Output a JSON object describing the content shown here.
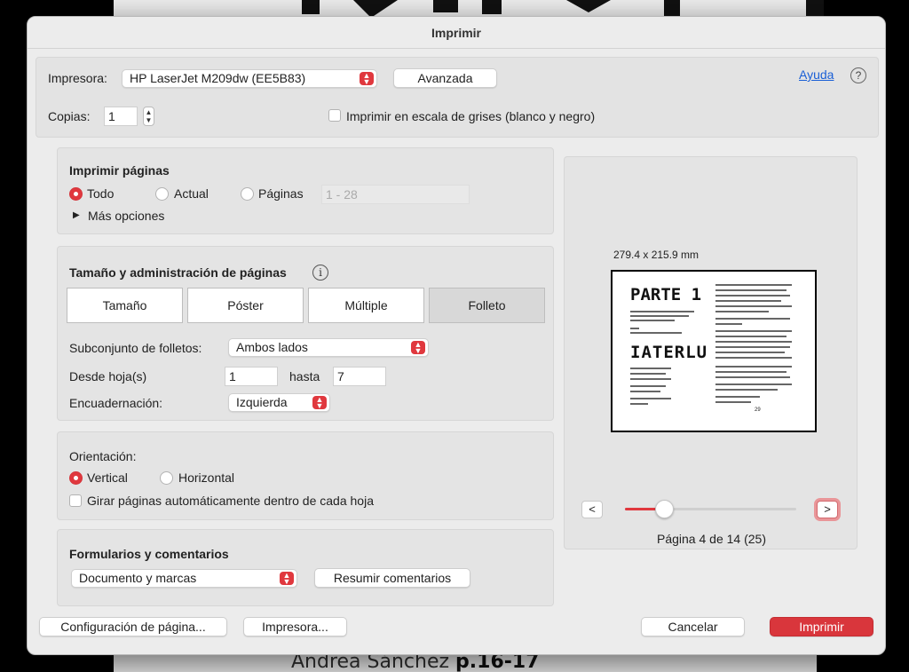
{
  "background": {
    "caption_name": "Andrea Sánchez",
    "caption_pages": "p.16-17"
  },
  "dialog": {
    "title": "Imprimir",
    "printer": {
      "label": "Impresora:",
      "value": "HP LaserJet M209dw (EE5B83)",
      "advanced_button": "Avanzada"
    },
    "help": {
      "link": "Ayuda",
      "icon": "?"
    },
    "copies": {
      "label": "Copias:",
      "value": "1"
    },
    "grayscale_label": "Imprimir en escala de grises (blanco y negro)",
    "print_pages": {
      "title": "Imprimir páginas",
      "options": [
        "Todo",
        "Actual",
        "Páginas"
      ],
      "selected": "Todo",
      "range_placeholder": "1 - 28",
      "more_options": "Más opciones"
    },
    "page_size": {
      "title": "Tamaño y administración de páginas",
      "info_icon": "i",
      "tabs": [
        "Tamaño",
        "Póster",
        "Múltiple",
        "Folleto"
      ],
      "selected_tab": "Folleto",
      "booklet_subset_label": "Subconjunto de folletos:",
      "booklet_subset_value": "Ambos lados",
      "from_sheet_label": "Desde hoja(s)",
      "from_value": "1",
      "to_label": "hasta",
      "to_value": "7",
      "binding_label": "Encuadernación:",
      "binding_value": "Izquierda"
    },
    "orientation": {
      "title": "Orientación:",
      "options": [
        "Vertical",
        "Horizontal"
      ],
      "selected": "Vertical",
      "auto_rotate_label": "Girar páginas automáticamente dentro de cada hoja"
    },
    "forms": {
      "title": "Formularios y comentarios",
      "value": "Documento y marcas",
      "summarize_button": "Resumir comentarios"
    },
    "preview": {
      "paper_size": "279.4 x 215.9 mm",
      "mini_title_1": "PARTE 1",
      "mini_title_2": "IATERLU",
      "mini_page_number": "29",
      "prev": "<",
      "next": ">",
      "page_label": "Página 4 de 14 (25)",
      "slider_fraction": 0.23
    },
    "footer": {
      "page_setup": "Configuración de página...",
      "printer": "Impresora...",
      "cancel": "Cancelar",
      "print": "Imprimir"
    }
  },
  "colors": {
    "accent": "#e0383e",
    "link": "#1a5fd6"
  }
}
